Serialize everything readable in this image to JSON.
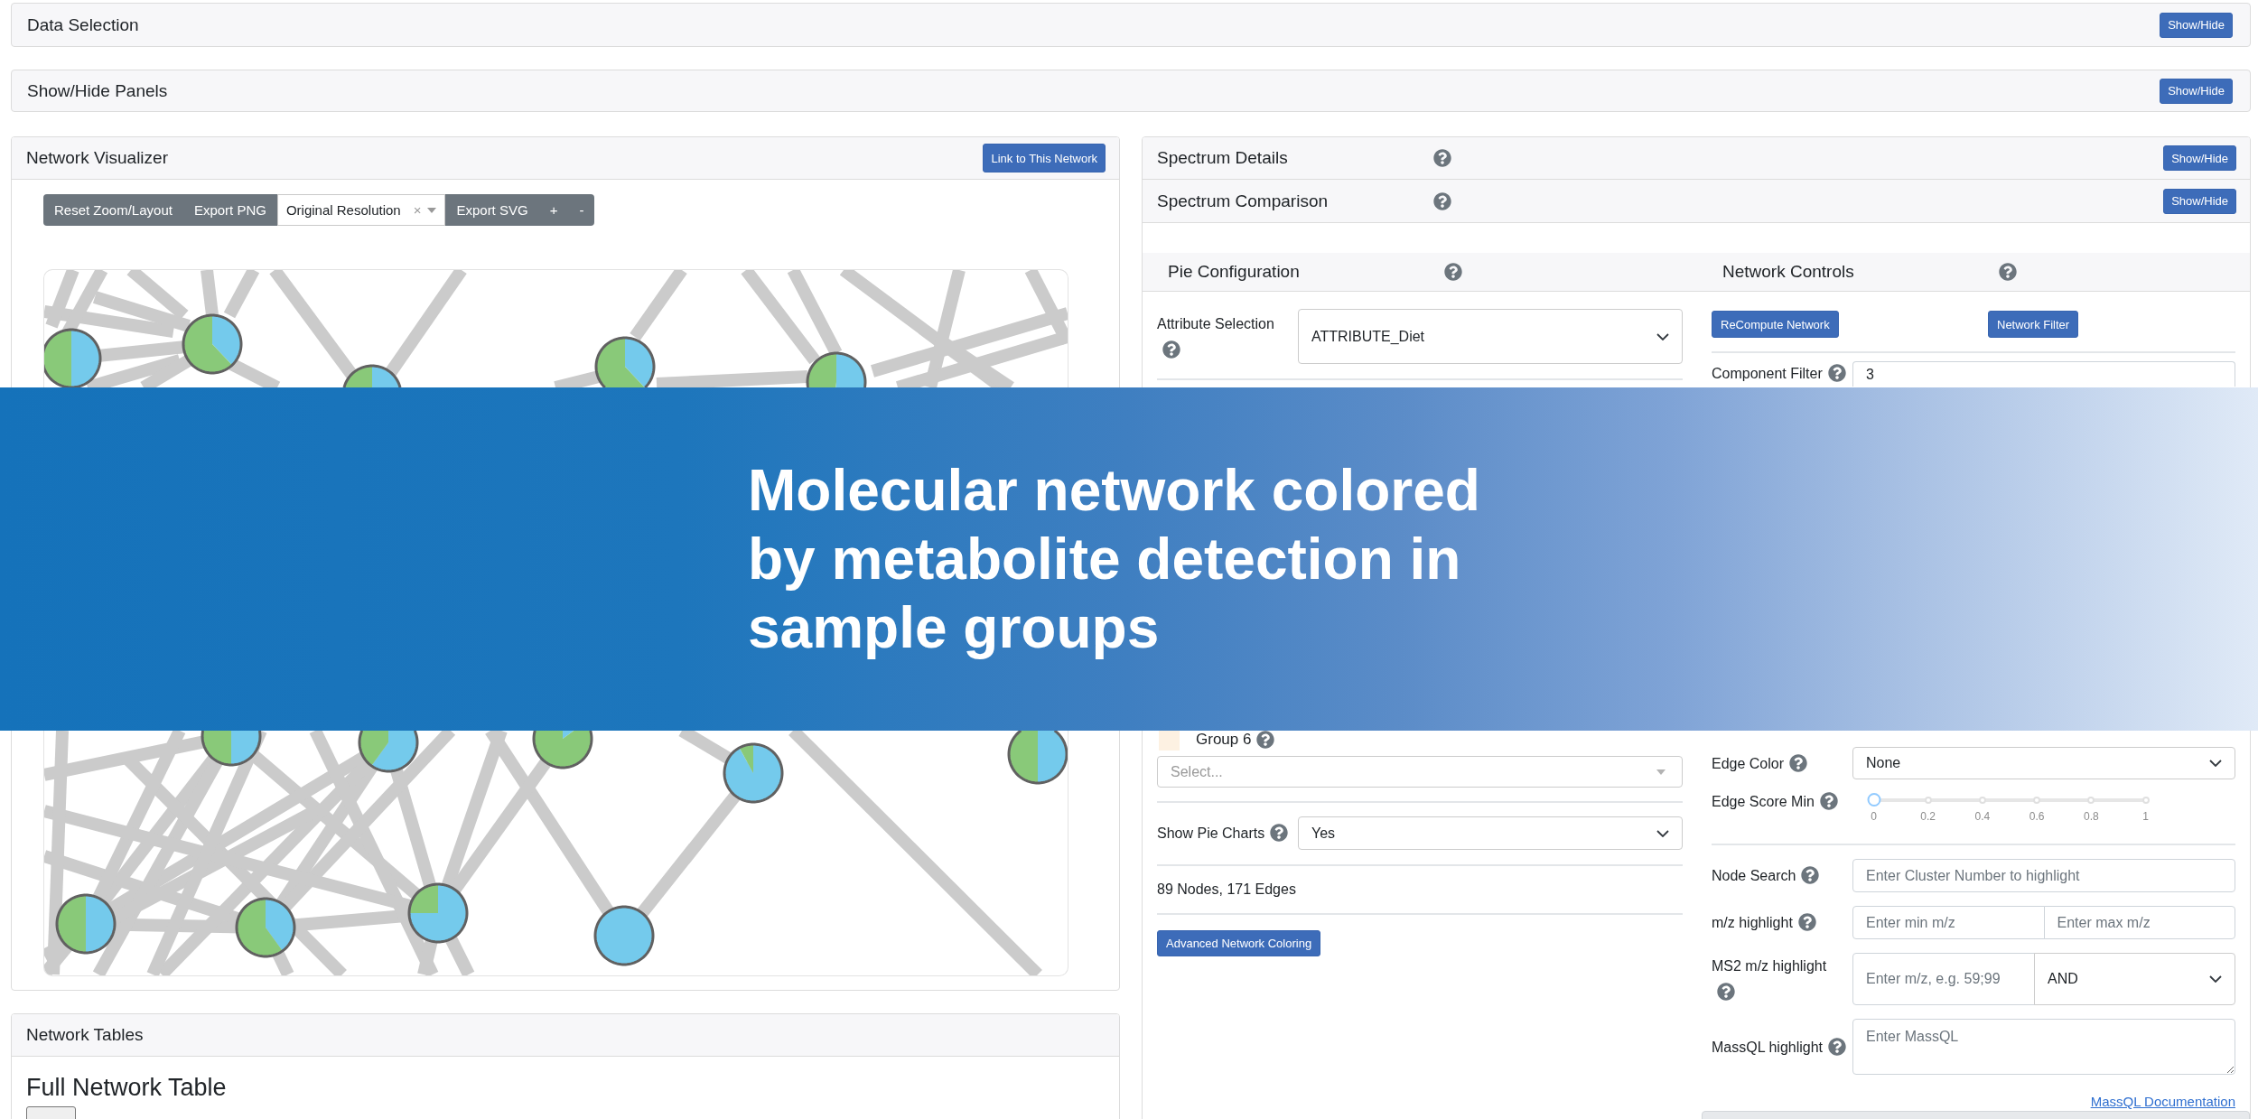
{
  "panels": [
    {
      "title": "Data Selection",
      "button": "Show/Hide"
    },
    {
      "title": "Show/Hide Panels",
      "button": "Show/Hide"
    }
  ],
  "network_visualizer": {
    "title": "Network Visualizer",
    "button": "Link to This Network",
    "toolbar": [
      {
        "kind": "button",
        "label": "Reset Zoom/Layout"
      },
      {
        "kind": "button",
        "label": "Export PNG"
      },
      {
        "kind": "select",
        "value": "Original Resolution",
        "clear": "×"
      },
      {
        "kind": "button",
        "label": "Export SVG"
      },
      {
        "kind": "button",
        "label": "+"
      },
      {
        "kind": "button",
        "label": "-"
      }
    ]
  },
  "network_tables": {
    "title": "Network Tables",
    "heading": "Full Network Table"
  },
  "spectrum_panels": [
    {
      "title": "Spectrum Details",
      "button": "Show/Hide"
    },
    {
      "title": "Spectrum Comparison",
      "button": "Show/Hide"
    }
  ],
  "pie_configuration": {
    "title": "Pie Configuration",
    "attribute_selection": {
      "label": "Attribute Selection",
      "value": "ATTRIBUTE_Diet"
    },
    "groups": [
      {
        "label": "Group 6",
        "color": "#fdf1e2"
      }
    ],
    "group_select": {
      "placeholder": "Select..."
    },
    "show_pie_charts": {
      "label": "Show Pie Charts",
      "value": "Yes"
    },
    "summary": "89 Nodes, 171 Edges",
    "button": "Advanced Network Coloring"
  },
  "network_controls": {
    "title": "Network Controls",
    "buttons": [
      "ReCompute Network",
      "Network Filter"
    ],
    "component_filter": {
      "label": "Component Filter",
      "value": "3"
    },
    "fields": [
      {
        "kind": "select",
        "label": "Edge Color",
        "value": "None"
      },
      {
        "kind": "slider",
        "label": "Edge Score Min",
        "level": 0,
        "ticks": [
          "0",
          "0.2",
          "0.4",
          "0.6",
          "0.8",
          "1"
        ]
      },
      {
        "kind": "input",
        "label": "Node Search",
        "placeholder": "Enter Cluster Number to highlight"
      },
      {
        "kind": "range",
        "label": "m/z highlight",
        "placeholders": [
          "Enter min m/z",
          "Enter max m/z"
        ]
      },
      {
        "kind": "input_select",
        "label": "MS2 m/z highlight",
        "placeholder": "Enter m/z, e.g. 59;99",
        "value": "AND"
      },
      {
        "kind": "textarea",
        "label": "MassQL highlight",
        "placeholder": "Enter MassQL"
      }
    ],
    "link": "MassQL Documentation"
  },
  "banner": {
    "title": "Molecular network colored by metabolite detection in sample groups"
  }
}
